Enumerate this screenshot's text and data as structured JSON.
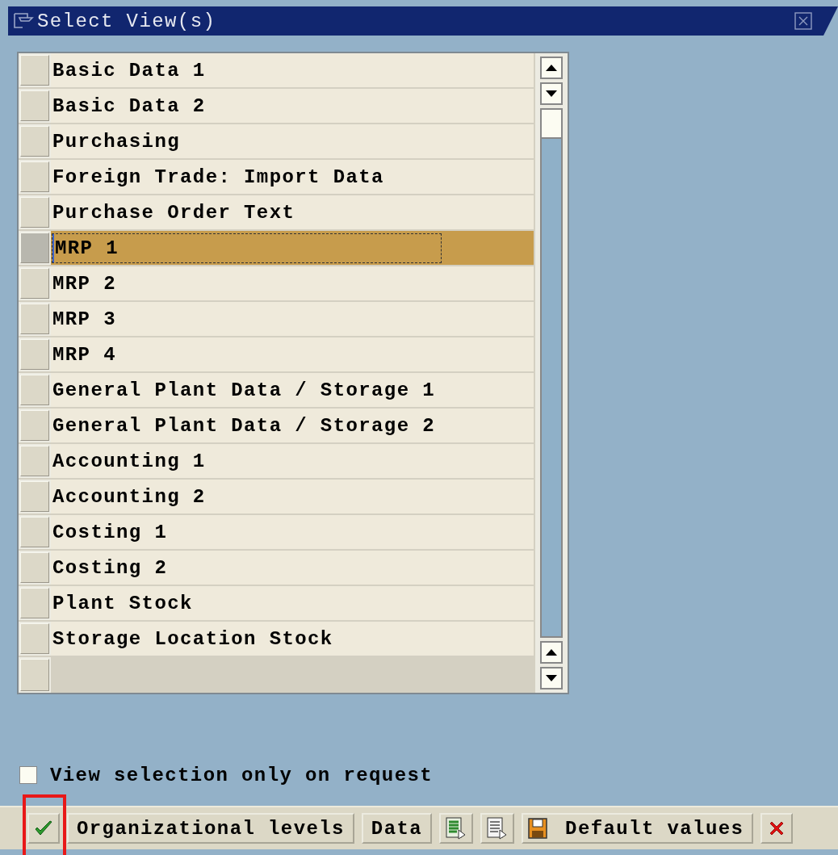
{
  "window": {
    "title": "Select View(s)"
  },
  "views": [
    {
      "label": "Basic Data 1",
      "selected": false
    },
    {
      "label": "Basic Data 2",
      "selected": false
    },
    {
      "label": "Purchasing",
      "selected": false
    },
    {
      "label": "Foreign Trade: Import Data",
      "selected": false
    },
    {
      "label": "Purchase Order Text",
      "selected": false
    },
    {
      "label": "MRP 1",
      "selected": true
    },
    {
      "label": "MRP 2",
      "selected": false
    },
    {
      "label": "MRP 3",
      "selected": false
    },
    {
      "label": "MRP 4",
      "selected": false
    },
    {
      "label": "General Plant Data / Storage 1",
      "selected": false
    },
    {
      "label": "General Plant Data / Storage 2",
      "selected": false
    },
    {
      "label": "Accounting 1",
      "selected": false
    },
    {
      "label": "Accounting 2",
      "selected": false
    },
    {
      "label": "Costing 1",
      "selected": false
    },
    {
      "label": "Costing 2",
      "selected": false
    },
    {
      "label": "Plant Stock",
      "selected": false
    },
    {
      "label": "Storage Location Stock",
      "selected": false
    }
  ],
  "option": {
    "label": "View selection only on request",
    "checked": false
  },
  "buttons": [
    {
      "kind": "confirm",
      "highlighted": true
    },
    {
      "kind": "text",
      "label": "Organizational levels",
      "highlighted": false
    },
    {
      "kind": "text",
      "label": "Data",
      "highlighted": false
    },
    {
      "kind": "select-all",
      "highlighted": false
    },
    {
      "kind": "deselect-all",
      "highlighted": false
    },
    {
      "kind": "save",
      "label": "Default values",
      "highlighted": false
    },
    {
      "kind": "cancel",
      "highlighted": false
    }
  ]
}
